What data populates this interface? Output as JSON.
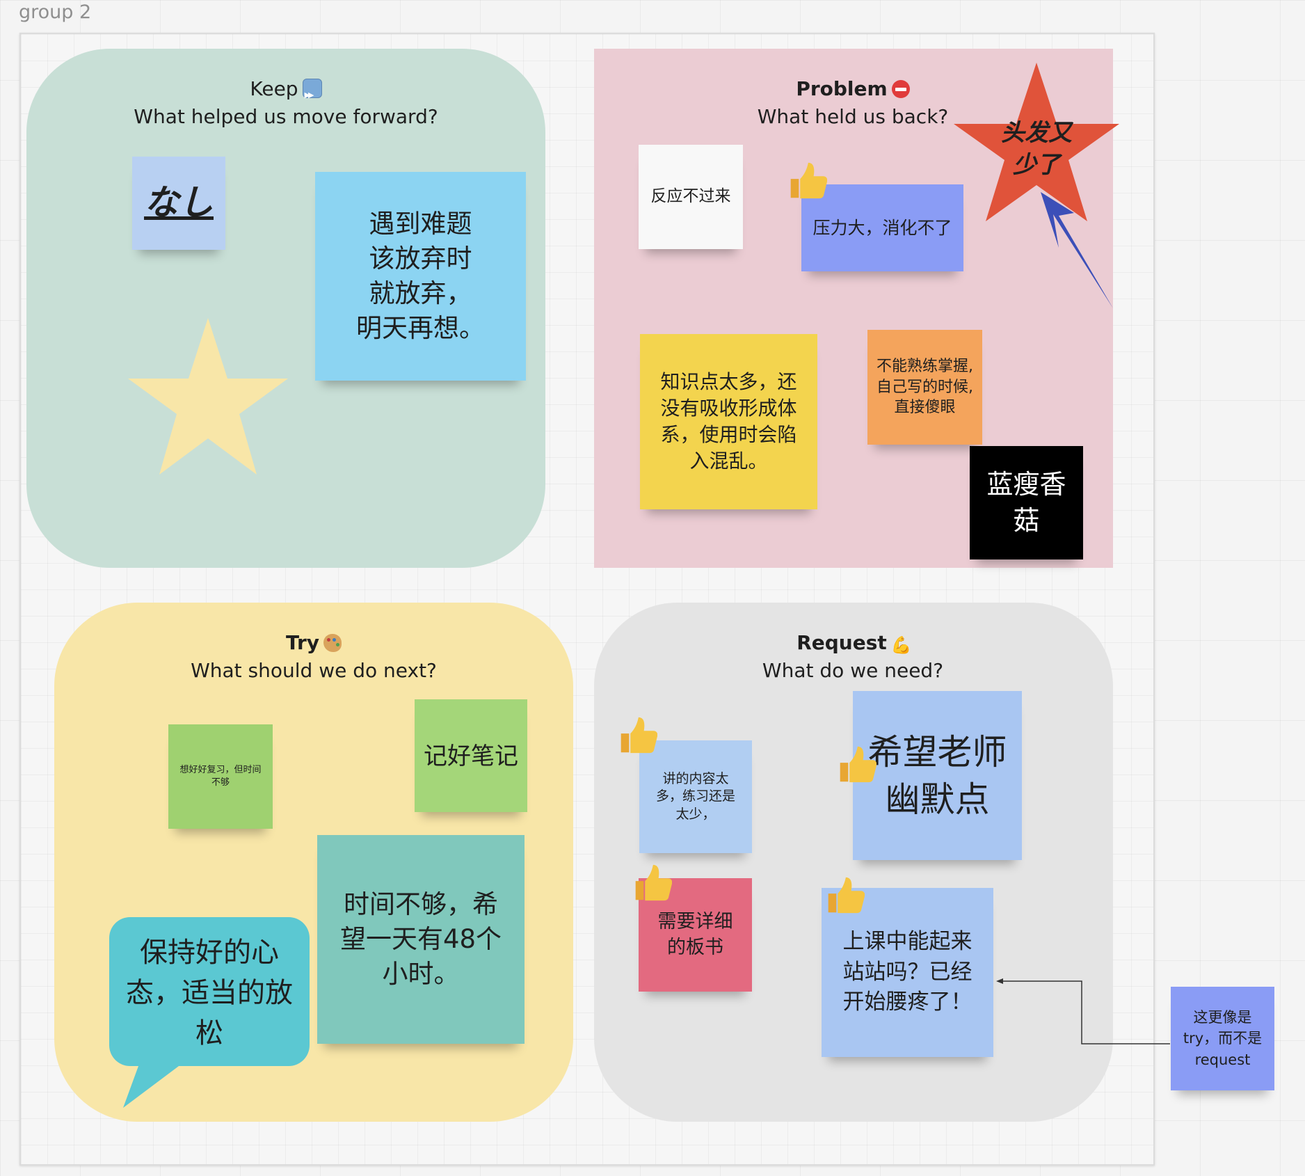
{
  "board": {
    "group_label": "group 2"
  },
  "keep": {
    "title": "Keep",
    "emoji": "fast-forward-emoji",
    "subtitle": "What helped us move forward?",
    "notes": [
      "なし",
      "遇到难题\n该放弃时\n就放弃，\n明天再想。"
    ]
  },
  "problem": {
    "title": "Problem",
    "emoji": "no-entry-emoji",
    "subtitle": "What held us back?",
    "notes": [
      "反应不过来",
      "压力大，消化不了",
      "知识点太多，还没有吸收形成体系，使用时会陷入混乱。",
      "不能熟练掌握,自己写的时候,直接傻眼",
      "蓝瘦香\n菇"
    ],
    "star_label": "头发又\n少了"
  },
  "try": {
    "title": "Try",
    "emoji": "palette-emoji",
    "subtitle": "What should we do next?",
    "notes": [
      "想好好复习，但时间不够",
      "记好笔记",
      "时间不够，希望一天有48个小时。",
      "保持好的心态，适当的放松"
    ]
  },
  "request": {
    "title": "Request",
    "emoji": "flexed-biceps-emoji",
    "subtitle": "What do we need?",
    "notes": [
      "讲的内容太多，练习还是太少，",
      "希望老师\n幽默点",
      "需要详细的板书",
      "上课中能起来站站吗？已经开始腰疼了！"
    ]
  },
  "outside_note": "这更像是try，而不是request",
  "colors": {
    "keep_bg": "#c8dfd6",
    "problem_bg": "#ebccd3",
    "try_bg": "#f8e6a8",
    "request_bg": "#e4e4e4",
    "star_red": "#e0533a",
    "star_yellow": "#f8e6a8",
    "arrow_blue": "#3c4fb8"
  }
}
